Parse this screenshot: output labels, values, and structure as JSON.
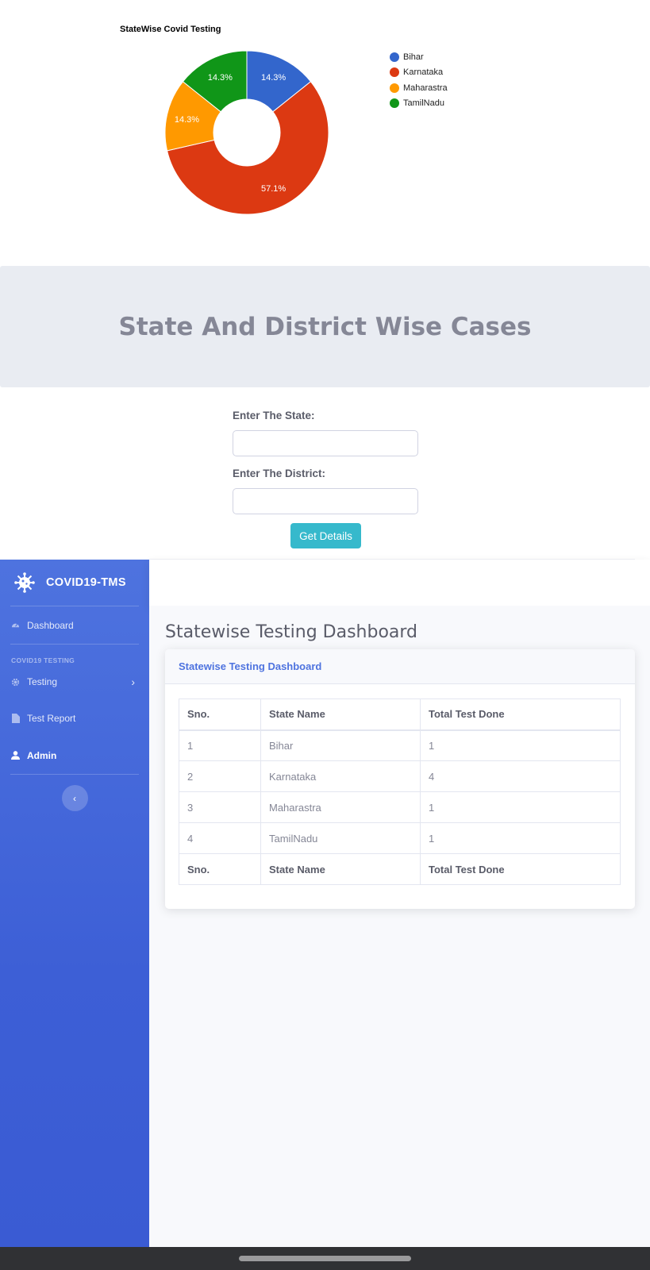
{
  "chart": {
    "title": "StateWise Covid Testing",
    "legend": [
      {
        "label": "Bihar",
        "color": "#3366cc"
      },
      {
        "label": "Karnataka",
        "color": "#dc3912"
      },
      {
        "label": "Maharastra",
        "color": "#ff9900"
      },
      {
        "label": "TamilNadu",
        "color": "#109618"
      }
    ]
  },
  "chart_data": {
    "type": "pie",
    "title": "StateWise Covid Testing",
    "donut": true,
    "legend_position": "right",
    "categories": [
      "Bihar",
      "Karnataka",
      "Maharastra",
      "TamilNadu"
    ],
    "values": [
      1,
      4,
      1,
      1
    ],
    "labels": [
      "14.3%",
      "57.1%",
      "14.3%",
      "14.3%"
    ],
    "colors": [
      "#3366cc",
      "#dc3912",
      "#ff9900",
      "#109618"
    ]
  },
  "banner": {
    "title": "State And District Wise Cases"
  },
  "form": {
    "state_label": "Enter The State:",
    "district_label": "Enter The District:",
    "state_value": "",
    "district_value": "",
    "button_label": "Get Details"
  },
  "sidebar": {
    "brand": "COVID19-TMS",
    "dashboard": "Dashboard",
    "heading": "COVID19 TESTING",
    "testing": "Testing",
    "test_report": "Test Report",
    "admin": "Admin",
    "toggle": "‹"
  },
  "main": {
    "page_title": "Statewise Testing Dashboard",
    "card_title": "Statewise Testing Dashboard",
    "columns": [
      "Sno.",
      "State Name",
      "Total Test Done"
    ],
    "rows": [
      [
        "1",
        "Bihar",
        "1"
      ],
      [
        "2",
        "Karnataka",
        "4"
      ],
      [
        "3",
        "Maharastra",
        "1"
      ],
      [
        "4",
        "TamilNadu",
        "1"
      ]
    ]
  }
}
